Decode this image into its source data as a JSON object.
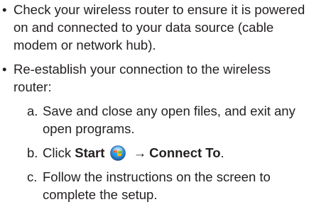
{
  "bullets": [
    {
      "symbol": "•",
      "text": "Check your wireless router to ensure it is powered on and connected to your data source (cable modem or network hub)."
    },
    {
      "symbol": "•",
      "text": "Re-establish your connection to the wireless router:",
      "steps": [
        {
          "marker": "a.",
          "text": "Save and close any open files, and exit any open programs."
        },
        {
          "marker": "b.",
          "prefix": "Click ",
          "bold1": "Start",
          "icon": "windows-start-orb-icon",
          "arrow": "→",
          "bold2": "Connect To",
          "suffix": "."
        },
        {
          "marker": "c.",
          "text": "Follow the instructions on the screen to complete the setup."
        }
      ]
    }
  ]
}
